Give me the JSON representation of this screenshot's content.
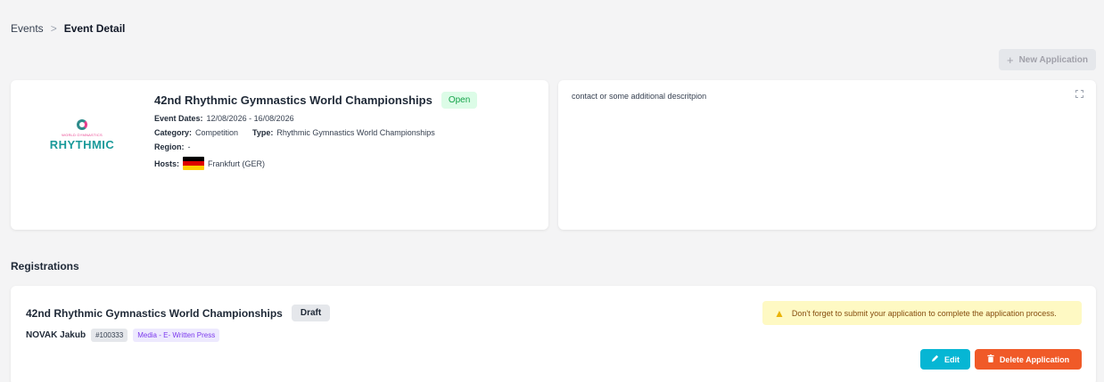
{
  "breadcrumb": {
    "parent": "Events",
    "separator": ">",
    "current": "Event Detail"
  },
  "toolbar": {
    "new_application_label": "New Application",
    "new_application_icon": "plus-icon"
  },
  "event": {
    "logo": {
      "subtitle": "WORLD GYMNASTICS",
      "wordmark": "RHYTHMIC"
    },
    "title": "42nd Rhythmic Gymnastics World Championships",
    "status": "Open",
    "dates_label": "Event Dates:",
    "dates_value": "12/08/2026 - 16/08/2026",
    "category_label": "Category:",
    "category_value": "Competition",
    "type_label": "Type:",
    "type_value": "Rhythmic Gymnastics World Championships",
    "region_label": "Region:",
    "region_value": "-",
    "hosts_label": "Hosts:",
    "host_city": "Frankfurt (GER)",
    "host_flag_colors": [
      "#000000",
      "#dd0000",
      "#ffce00"
    ]
  },
  "description": {
    "text": "contact or some additional descritpion",
    "expand_icon": "expand-icon"
  },
  "registrations": {
    "section_title": "Registrations",
    "items": [
      {
        "title": "42nd Rhythmic Gymnastics World Championships",
        "status": "Draft",
        "person_name": "NOVAK Jakub",
        "person_id": "#100333",
        "role": "Media - E- Written Press",
        "alert_text": "Don't forget to submit your application to complete the application process.",
        "edit_label": "Edit",
        "delete_label": "Delete Application"
      }
    ]
  },
  "colors": {
    "open_badge_bg": "#dcfce7",
    "open_badge_text": "#16a34a",
    "edit_button": "#06b6d4",
    "delete_button": "#f05a28",
    "alert_bg": "#fef9c3",
    "role_tag_text": "#7c3aed"
  }
}
